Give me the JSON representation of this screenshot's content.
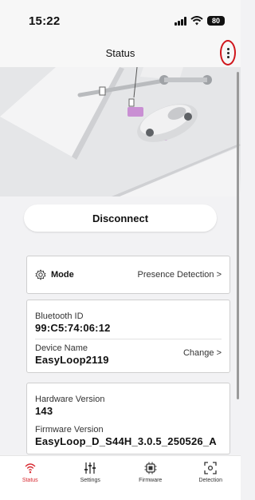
{
  "status_bar": {
    "time": "15:22",
    "battery": "80"
  },
  "nav": {
    "title": "Status",
    "more_icon": "more-vertical-icon"
  },
  "actions": {
    "disconnect_label": "Disconnect"
  },
  "mode": {
    "label": "Mode",
    "value": "Presence Detection >"
  },
  "bluetooth": {
    "id_label": "Bluetooth ID",
    "id_value": "99:C5:74:06:12",
    "name_label": "Device Name",
    "name_value": "EasyLoop2119",
    "change_label": "Change >"
  },
  "versions": {
    "hardware_label": "Hardware Version",
    "hardware_value": "143",
    "firmware_label": "Firmware Version",
    "firmware_value": "EasyLoop_D_S44H_3.0.5_250526_A"
  },
  "tabs": [
    {
      "label": "Status",
      "icon": "signal-icon",
      "active": true
    },
    {
      "label": "Settings",
      "icon": "sliders-icon",
      "active": false
    },
    {
      "label": "Firmware",
      "icon": "chip-icon",
      "active": false
    },
    {
      "label": "Detection",
      "icon": "detection-icon",
      "active": false
    }
  ],
  "colors": {
    "accent": "#d7282f",
    "highlight": "#d0161c",
    "sensor": "#c98fd3"
  }
}
